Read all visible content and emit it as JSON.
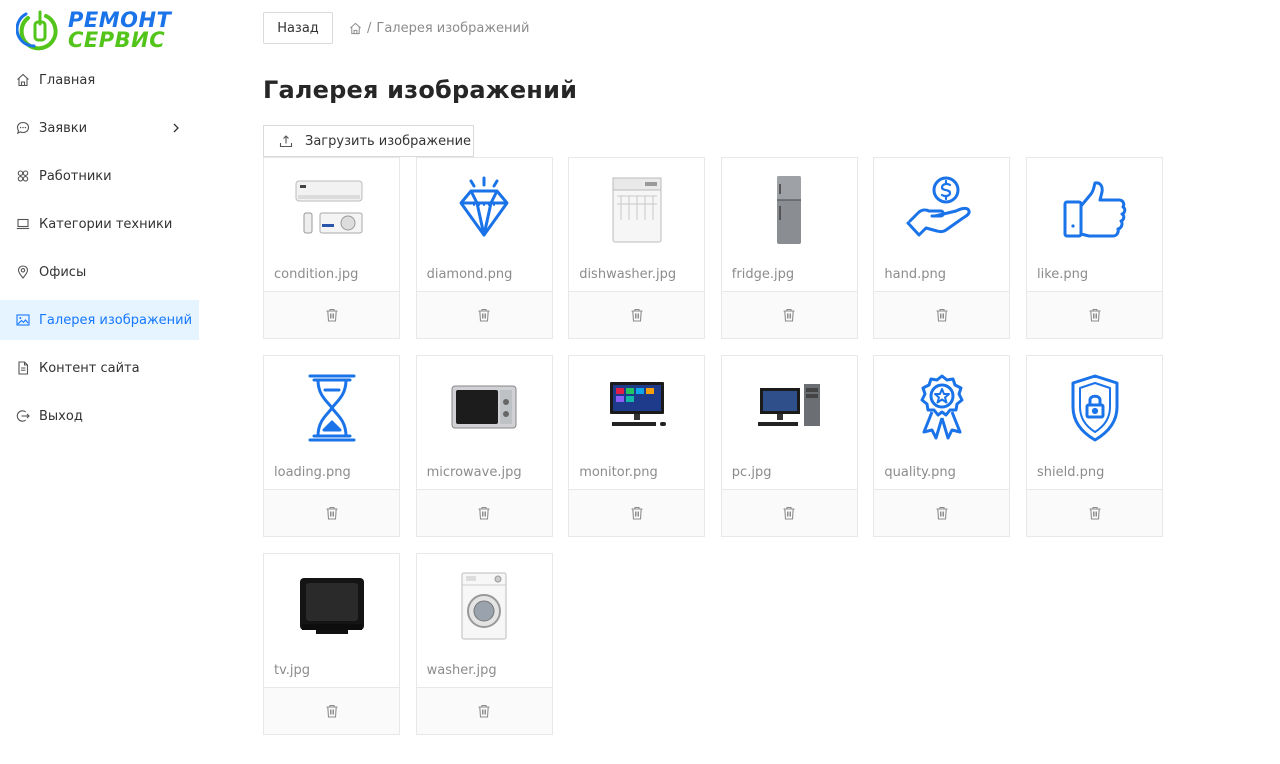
{
  "brand": {
    "line1": "РЕМОНТ",
    "line2": "СЕРВИС",
    "accent": "#1a73e8",
    "green": "#52c41a"
  },
  "sidebar": {
    "items": [
      {
        "label": "Главная",
        "icon": "home-icon",
        "active": false
      },
      {
        "label": "Заявки",
        "icon": "chat-icon",
        "active": false,
        "has_submenu": true
      },
      {
        "label": "Работники",
        "icon": "team-icon",
        "active": false
      },
      {
        "label": "Категории техники",
        "icon": "laptop-icon",
        "active": false
      },
      {
        "label": "Офисы",
        "icon": "location-icon",
        "active": false
      },
      {
        "label": "Галерея изображений",
        "icon": "picture-icon",
        "active": true
      },
      {
        "label": "Контент сайта",
        "icon": "file-icon",
        "active": false
      },
      {
        "label": "Выход",
        "icon": "logout-icon",
        "active": false
      }
    ],
    "active_bg": "#e6f4ff",
    "active_color": "#1677ff"
  },
  "topbar": {
    "back_label": "Назад",
    "breadcrumb_sep": "/",
    "breadcrumb_current": "Галерея изображений"
  },
  "page": {
    "title": "Галерея изображений",
    "upload_label": "Загрузить изображение"
  },
  "gallery": [
    {
      "filename": "condition.jpg",
      "kind": "air-conditioner"
    },
    {
      "filename": "diamond.png",
      "kind": "diamond"
    },
    {
      "filename": "dishwasher.jpg",
      "kind": "dishwasher"
    },
    {
      "filename": "fridge.jpg",
      "kind": "fridge"
    },
    {
      "filename": "hand.png",
      "kind": "hand-coin"
    },
    {
      "filename": "like.png",
      "kind": "like"
    },
    {
      "filename": "loading.png",
      "kind": "hourglass"
    },
    {
      "filename": "microwave.jpg",
      "kind": "microwave"
    },
    {
      "filename": "monitor.png",
      "kind": "monitor"
    },
    {
      "filename": "pc.jpg",
      "kind": "pc"
    },
    {
      "filename": "quality.png",
      "kind": "quality-badge"
    },
    {
      "filename": "shield.png",
      "kind": "shield"
    },
    {
      "filename": "tv.jpg",
      "kind": "tv"
    },
    {
      "filename": "washer.jpg",
      "kind": "washer"
    }
  ]
}
